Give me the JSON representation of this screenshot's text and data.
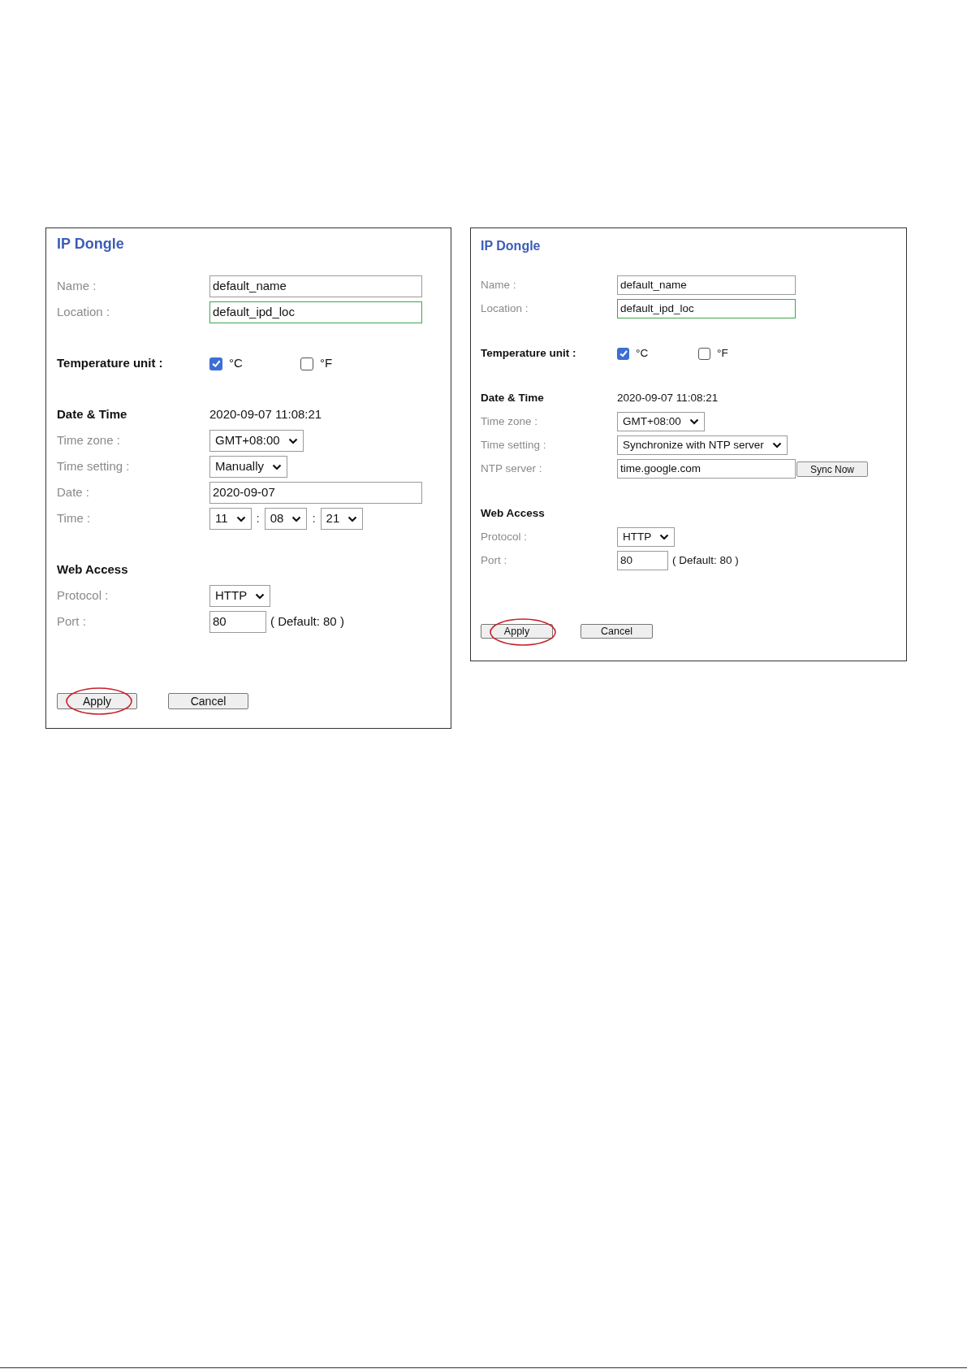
{
  "panels": [
    {
      "title": "IP Dongle",
      "rows": [
        {
          "kind": "field",
          "label": "Name :",
          "value": "default_name",
          "focused": false
        },
        {
          "kind": "field",
          "label": "Location :",
          "value": "default_ipd_loc",
          "focused": true
        },
        {
          "kind": "checkboxes",
          "label": "Temperature unit :",
          "options": [
            {
              "label": "°C",
              "checked": true
            },
            {
              "label": "°F",
              "checked": false
            }
          ]
        },
        {
          "kind": "heading",
          "label": "Date & Time",
          "value": "2020-09-07 11:08:21"
        },
        {
          "kind": "select",
          "label": "Time zone :",
          "value": "GMT+08:00"
        },
        {
          "kind": "select",
          "label": "Time setting :",
          "value": "Manually"
        },
        {
          "kind": "field",
          "label": "Date :",
          "value": "2020-09-07",
          "focused": false
        },
        {
          "kind": "time",
          "label": "Time :",
          "parts": [
            "11",
            "08",
            "21"
          ],
          "separators": [
            ":",
            ":"
          ]
        },
        {
          "kind": "heading",
          "label": "Web Access"
        },
        {
          "kind": "select",
          "label": "Protocol :",
          "value": "HTTP"
        },
        {
          "kind": "port",
          "label": "Port :",
          "value": "80",
          "note": "( Default: 80 )"
        }
      ],
      "buttons": [
        {
          "label": "Apply",
          "circled": true
        },
        {
          "label": "Cancel",
          "circled": false
        }
      ]
    },
    {
      "title": "IP Dongle",
      "rows": [
        {
          "kind": "field",
          "label": "Name :",
          "value": "default_name",
          "focused": false
        },
        {
          "kind": "field",
          "label": "Location :",
          "value": "default_ipd_loc",
          "focused": true
        },
        {
          "kind": "checkboxes",
          "label": "Temperature unit :",
          "options": [
            {
              "label": "°C",
              "checked": true
            },
            {
              "label": "°F",
              "checked": false
            }
          ]
        },
        {
          "kind": "heading",
          "label": "Date & Time",
          "value": "2020-09-07 11:08:21"
        },
        {
          "kind": "select",
          "label": "Time zone :",
          "value": "GMT+08:00"
        },
        {
          "kind": "select",
          "label": "Time setting :",
          "value": "Synchronize with NTP server"
        },
        {
          "kind": "ntp",
          "label": "NTP server :",
          "value": "time.google.com",
          "button": "Sync Now"
        },
        {
          "kind": "heading",
          "label": "Web Access"
        },
        {
          "kind": "select",
          "label": "Protocol :",
          "value": "HTTP"
        },
        {
          "kind": "port",
          "label": "Port :",
          "value": "80",
          "note": "( Default: 80 )"
        }
      ],
      "buttons": [
        {
          "label": "Apply",
          "circled": true
        },
        {
          "label": "Cancel",
          "circled": false
        }
      ]
    }
  ]
}
